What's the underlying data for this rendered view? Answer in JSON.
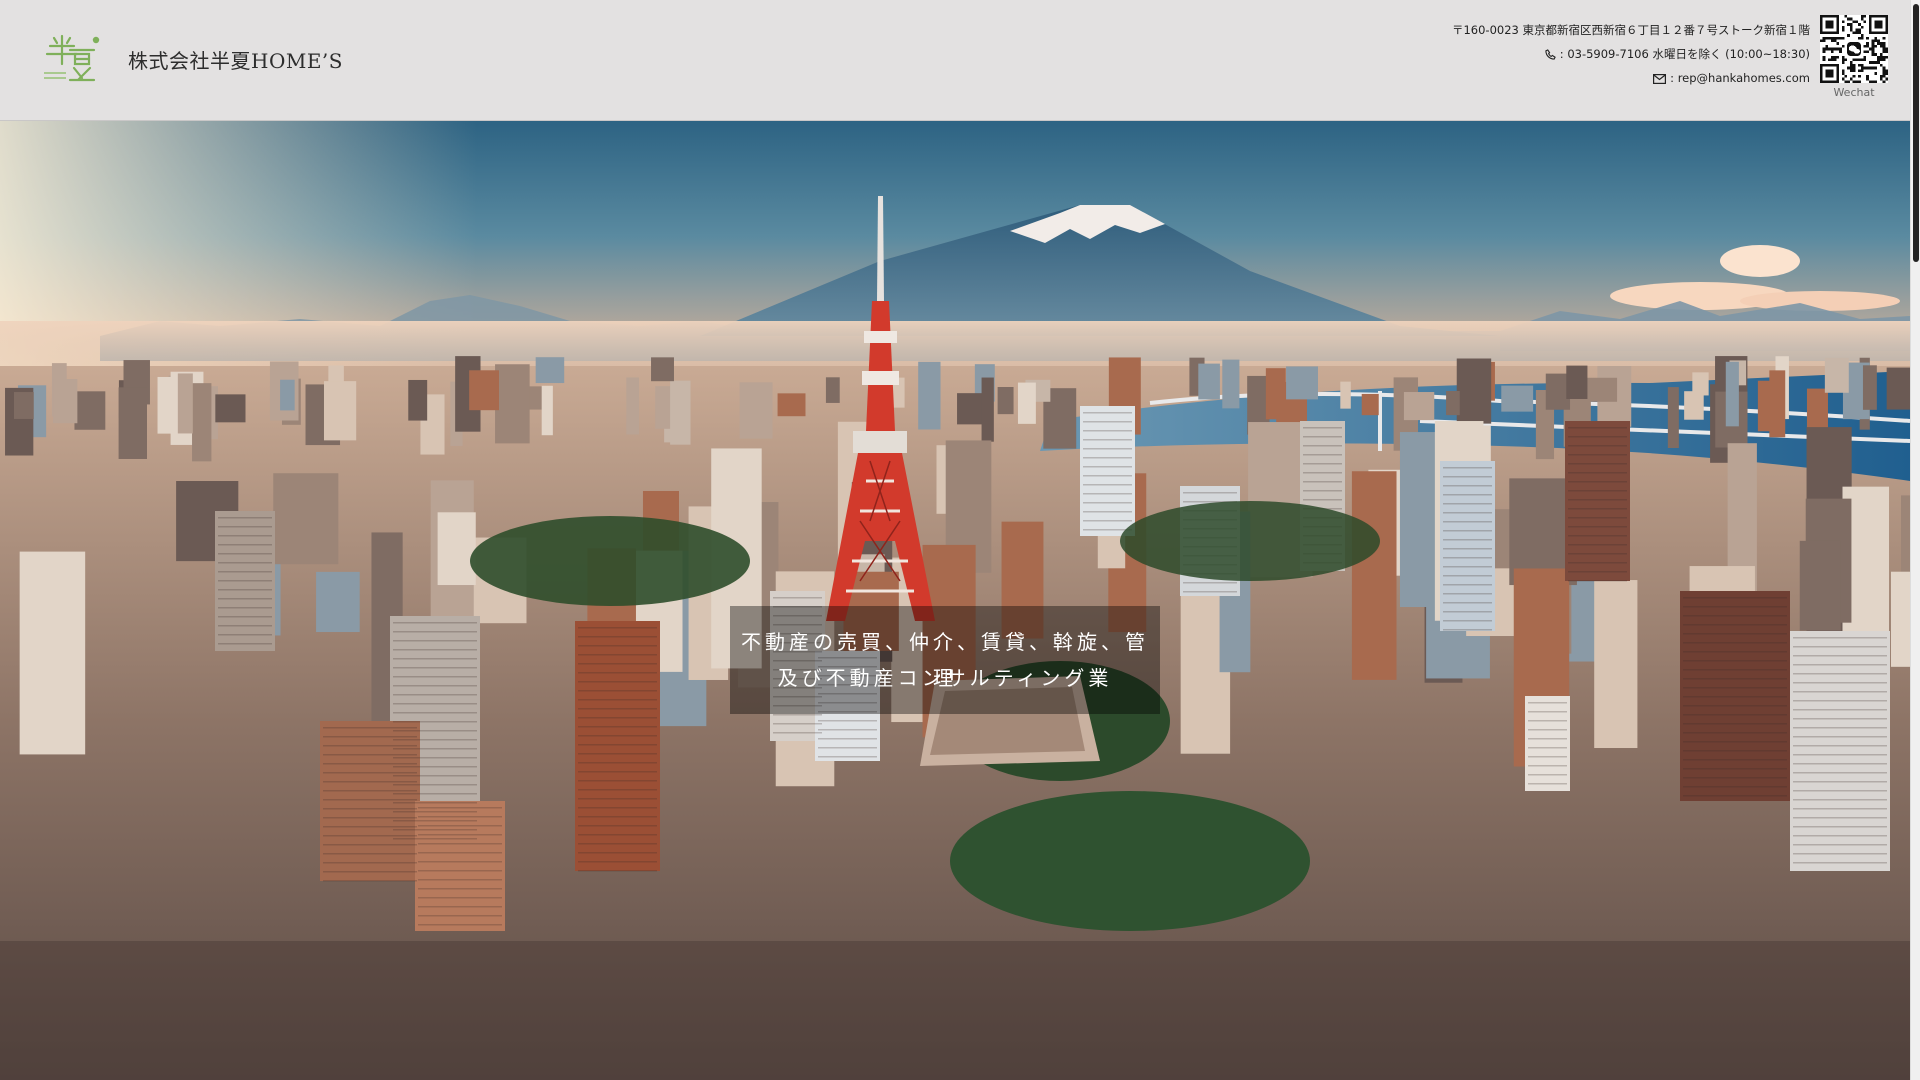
{
  "header": {
    "company_name": "株式会社半夏HOME’S",
    "logo": {
      "icon": "hanka-logo-icon",
      "text_mark": "半夏",
      "color": "#7fb05a"
    },
    "address": "〒160-0023 東京都新宿区西新宿６丁目１２番７号ストーク新宿１階",
    "phone": ": 03-5909-7106 水曜日を除く (10:00~18:30)",
    "email": ": rep@hankahomes.com",
    "phone_icon": "phone-icon",
    "email_icon": "mail-icon",
    "qr_icon": "wechat-qr-icon",
    "qr_label": "Wechat"
  },
  "hero": {
    "image": "tokyo-skyline-mount-fuji",
    "tagline_line1": "不動産の売買、仲介、賃貸、斡旋、管理",
    "tagline_line2": "及び不動産コンサルティング業"
  },
  "colors": {
    "header_bg": "#e3e1e1",
    "logo_green": "#7fb05a",
    "tower_red": "#d23a2c",
    "bay_blue": "#2b6f99"
  }
}
